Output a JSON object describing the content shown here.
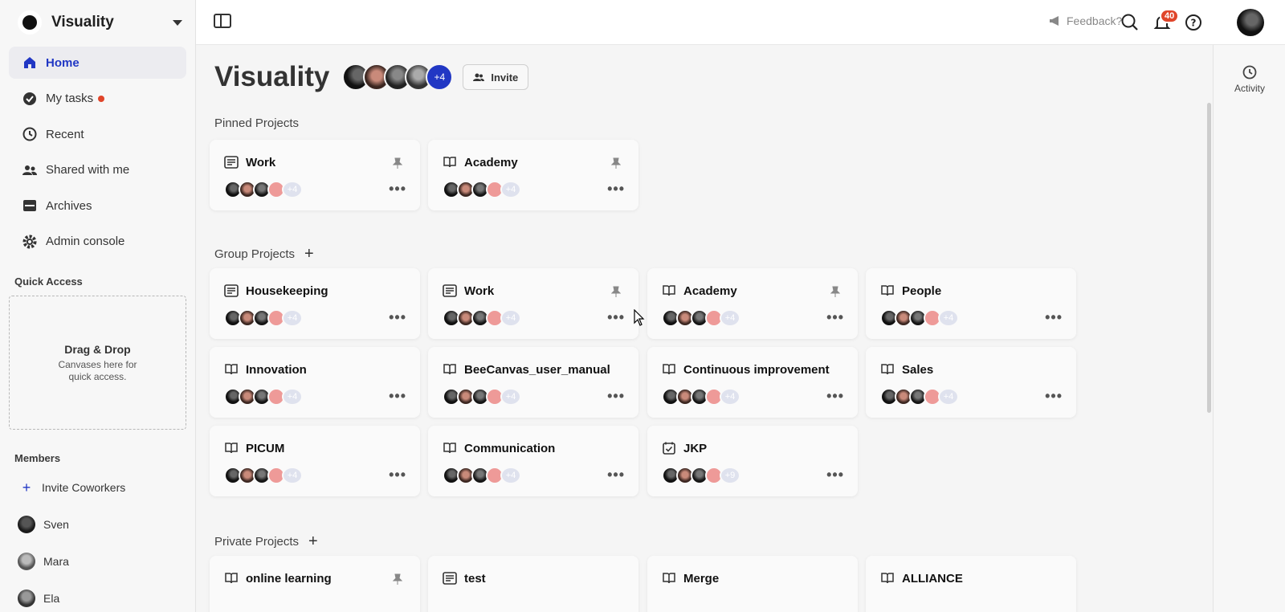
{
  "sidebar": {
    "brand": "Visuality",
    "nav": [
      {
        "label": "Home",
        "icon": "home-icon",
        "active": true
      },
      {
        "label": "My tasks",
        "icon": "check-circle-icon",
        "dot": true
      },
      {
        "label": "Recent",
        "icon": "history-icon"
      },
      {
        "label": "Shared with me",
        "icon": "people-icon"
      },
      {
        "label": "Archives",
        "icon": "archive-icon"
      },
      {
        "label": "Admin console",
        "icon": "gear-icon"
      }
    ],
    "quick_access": {
      "label": "Quick Access",
      "title": "Drag & Drop",
      "subtitle": "Canvases here for quick access."
    },
    "members": {
      "label": "Members",
      "invite": "Invite Coworkers",
      "list": [
        "Sven",
        "Mara",
        "Ela"
      ]
    }
  },
  "topbar": {
    "feedback": "Feedback?",
    "notification_count": "40"
  },
  "main": {
    "title": "Visuality",
    "members_more": "+4",
    "invite": "Invite",
    "pinned_label": "Pinned Projects",
    "group_label": "Group Projects",
    "private_label": "Private Projects",
    "pinned": [
      {
        "title": "Work",
        "icon": "board-icon",
        "more": "+4"
      },
      {
        "title": "Academy",
        "icon": "book-icon",
        "more": "+4"
      }
    ],
    "group": [
      {
        "title": "Housekeeping",
        "icon": "board-icon",
        "more": "+4"
      },
      {
        "title": "Work",
        "icon": "board-icon",
        "more": "+4"
      },
      {
        "title": "Academy",
        "icon": "book-icon",
        "more": "+4"
      },
      {
        "title": "People",
        "icon": "book-icon",
        "more": "+4"
      },
      {
        "title": "Innovation",
        "icon": "book-icon",
        "more": "+4"
      },
      {
        "title": "BeeCanvas_user_manual",
        "icon": "book-icon",
        "more": "+4"
      },
      {
        "title": "Continuous improvement",
        "icon": "book-icon",
        "more": "+4"
      },
      {
        "title": "Sales",
        "icon": "book-icon",
        "more": "+4"
      },
      {
        "title": "PICUM",
        "icon": "book-icon",
        "more": "+4"
      },
      {
        "title": "Communication",
        "icon": "book-icon",
        "more": "+4"
      },
      {
        "title": "JKP",
        "icon": "calendar-check-icon",
        "more": "+9"
      }
    ],
    "private": [
      {
        "title": "online learning",
        "icon": "book-icon"
      },
      {
        "title": "test",
        "icon": "board-icon"
      },
      {
        "title": "Merge",
        "icon": "book-icon"
      },
      {
        "title": "ALLIANCE",
        "icon": "book-icon"
      }
    ]
  },
  "rail": {
    "activity": "Activity"
  }
}
